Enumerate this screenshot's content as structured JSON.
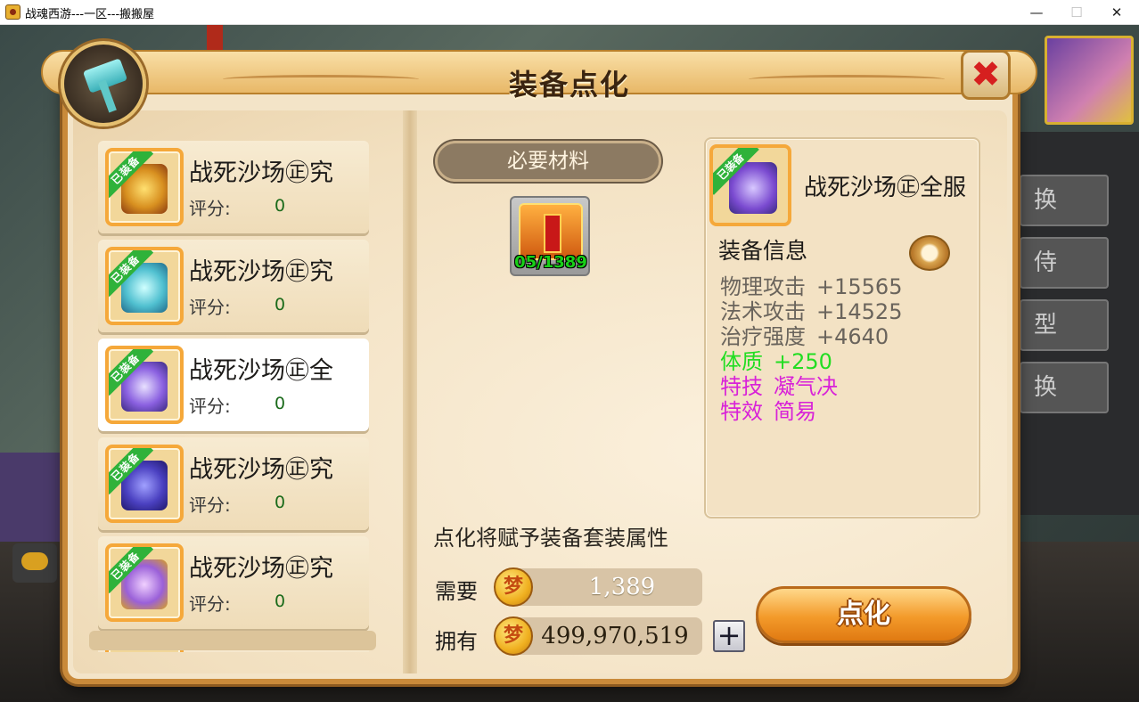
{
  "window": {
    "title": "战魂西游---一区---搬搬屋",
    "minimize": "—",
    "maximize": "☐",
    "close": "✕"
  },
  "dialog": {
    "title": "装备点化",
    "close_symbol": "✖"
  },
  "equipment_list": [
    {
      "badge": "已装备",
      "name": "战死沙场㊣究",
      "score_label": "评分:",
      "score": "0",
      "selected": false,
      "art_color": "#d89020"
    },
    {
      "badge": "已装备",
      "name": "战死沙场㊣究",
      "score_label": "评分:",
      "score": "0",
      "selected": false,
      "art_color": "#50c0d0"
    },
    {
      "badge": "已装备",
      "name": "战死沙场㊣全",
      "score_label": "评分:",
      "score": "0",
      "selected": true,
      "art_color": "#8a60e0"
    },
    {
      "badge": "已装备",
      "name": "战死沙场㊣究",
      "score_label": "评分:",
      "score": "0",
      "selected": false,
      "art_color": "#4a40c0"
    },
    {
      "badge": "已装备",
      "name": "战死沙场㊣究",
      "score_label": "评分:",
      "score": "0",
      "selected": false,
      "art_color": "#9a60d8"
    }
  ],
  "materials": {
    "heading": "必要材料",
    "item_count": "05/1389"
  },
  "set_note": "点化将赋予装备套装属性",
  "cost": {
    "need_label": "需要",
    "need_value": "1,389",
    "own_label": "拥有",
    "own_value": "499,970,519",
    "coin_glyph": "梦",
    "plus": "+"
  },
  "refine_button": "点化",
  "info": {
    "badge": "已装备",
    "name": "战死沙场㊣全服",
    "heading": "装备信息",
    "stats": [
      {
        "label": "物理攻击",
        "value": "+15565",
        "color": "gray"
      },
      {
        "label": "法术攻击",
        "value": "+14525",
        "color": "gray"
      },
      {
        "label": "治疗强度",
        "value": "+4640",
        "color": "gray"
      },
      {
        "label": "体质",
        "value": "+250",
        "color": "green"
      },
      {
        "label": "特技",
        "value": "凝气决",
        "color": "magenta"
      },
      {
        "label": "特效",
        "value": "简易",
        "color": "magenta"
      }
    ]
  },
  "background_side_buttons": [
    "换",
    "侍",
    "型",
    "换"
  ]
}
